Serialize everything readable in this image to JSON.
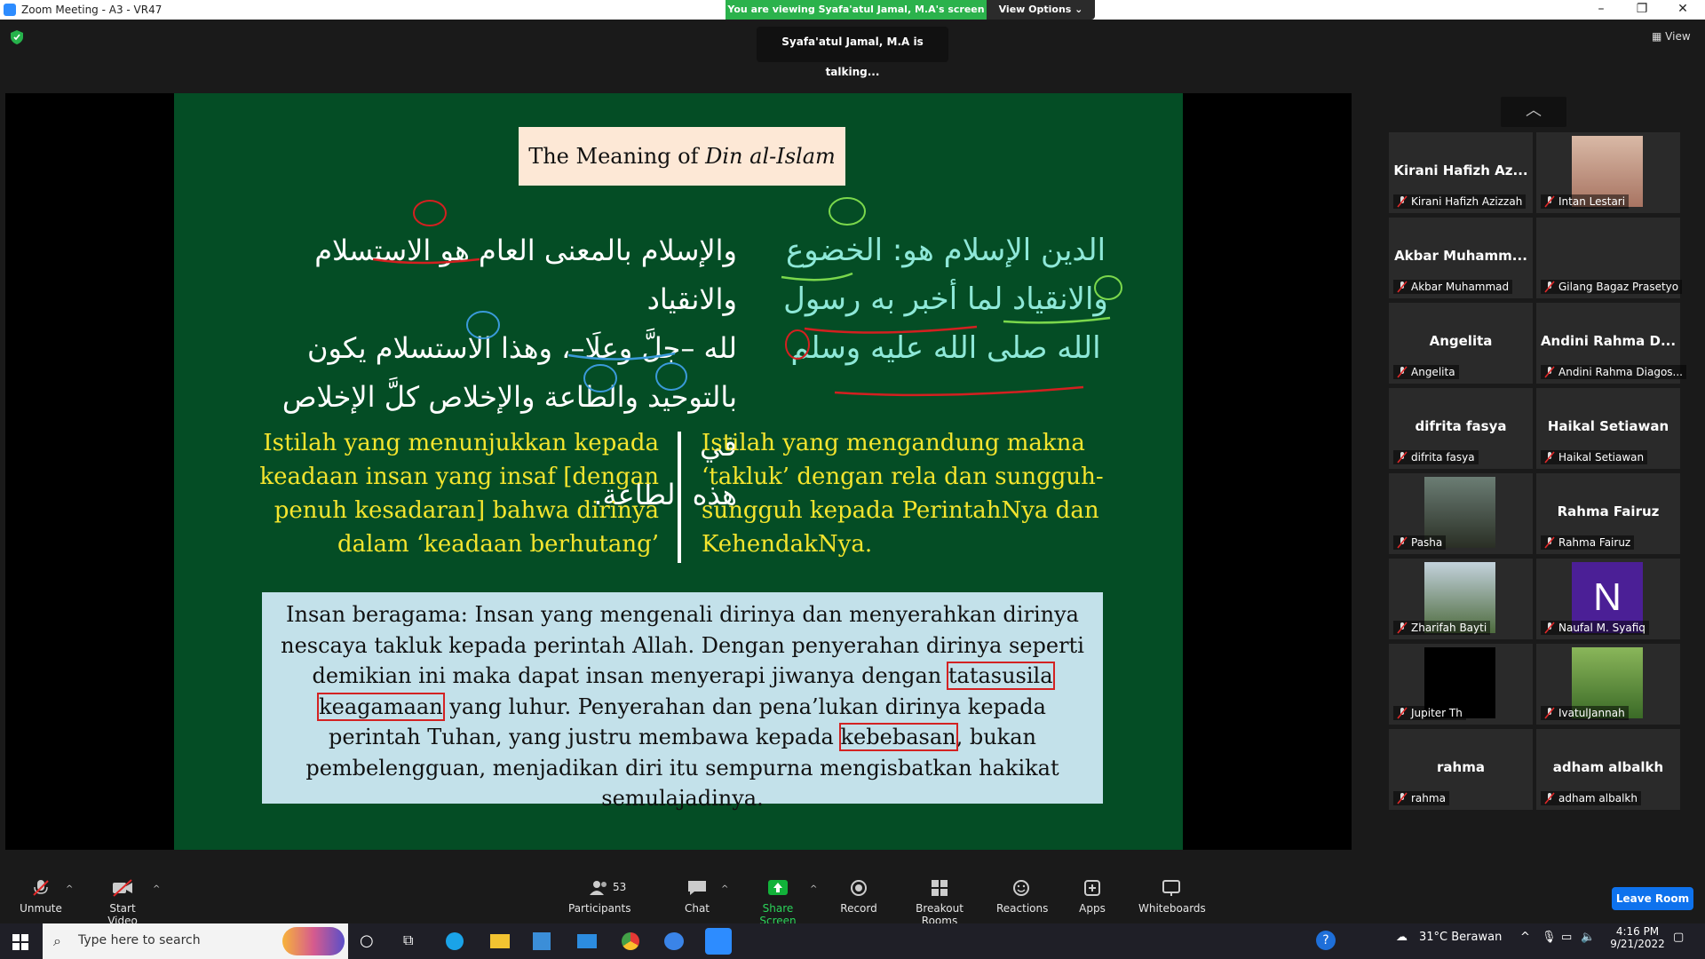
{
  "window": {
    "title": "Zoom Meeting - A3 - VR47"
  },
  "banner": {
    "viewing": "You are viewing Syafa'atul Jamal, M.A's screen",
    "view_options": "View Options"
  },
  "talking": "Syafa'atul Jamal, M.A is talking...",
  "view_button": "View",
  "slide": {
    "title_plain": "The Meaning of",
    "title_italic": "Din al-Islam",
    "arabic_left": [
      "والإسلام بالمعنى العام هو الاستسلام والانقياد",
      "لله –جلَّ وعلَا–، وهذا الاستسلام يكون",
      "بالتوحيد والطاعة والإخلاص كلَّ الإخلاص في",
      "هذه الطاعة."
    ],
    "arabic_right": [
      "الدين الإسلام هو: الخضوع",
      "والانقياد لما أخبر به رسول",
      "الله صلى الله عليه وسلم"
    ],
    "yellow_left": [
      "Istilah yang menunjukkan kepada",
      "keadaan insan yang insaf [dengan",
      "penuh kesadaran] bahwa dirinya",
      "dalam ‘keadaan berhutang’"
    ],
    "yellow_right": [
      "Istilah yang mengandung makna",
      "‘takluk’ dengan rela dan sungguh-",
      "sungguh kepada PerintahNya dan",
      "KehendakNya."
    ],
    "box": {
      "part1": "Insan beragama: Insan yang mengenali dirinya dan menyerahkan dirinya nescaya takluk kepada perintah Allah. Dengan penyerahan dirinya seperti demikian ini maka dapat insan menyerapi jiwanya dengan",
      "highlight1": "tatasusila keagamaan",
      "part2": "yang luhur. Penyerahan dan pena’lukan dirinya kepada perintah Tuhan, yang justru membawa kepada",
      "highlight2": "kebebasan",
      "part3": ", bukan pembelengguan, menjadikan diri itu sempurna mengisbatkan hakikat semulajadinya."
    }
  },
  "participants": [
    {
      "big": "Kirani Hafizh Az...",
      "label": "Kirani Hafizh Azizzah"
    },
    {
      "big": "",
      "label": "Intan Lestari",
      "photo": "woman-photo"
    },
    {
      "big": "Akbar Muhamm...",
      "label": "Akbar Muhammad"
    },
    {
      "big": "",
      "label": "Gilang Bagaz Prasetyo"
    },
    {
      "big": "Angelita",
      "label": "Angelita"
    },
    {
      "big": "Andini Rahma D...",
      "label": "Andini Rahma Diagos..."
    },
    {
      "big": "difrita fasya",
      "label": "difrita fasya"
    },
    {
      "big": "Haikal Setiawan",
      "label": "Haikal Setiawan"
    },
    {
      "big": "",
      "label": "Pasha",
      "photo": "tree-photo"
    },
    {
      "big": "Rahma Fairuz",
      "label": "Rahma Fairuz"
    },
    {
      "big": "",
      "label": "Zharifah Bayti",
      "photo": "garden-photo"
    },
    {
      "big": "N",
      "label": "Naufal M. Syafiq",
      "photo": "initial-avatar"
    },
    {
      "big": "",
      "label": "Jupiter Th",
      "photo": "black-photo"
    },
    {
      "big": "",
      "label": "IvatulJannah",
      "photo": "cartoon-photo"
    },
    {
      "big": "rahma",
      "label": "rahma"
    },
    {
      "big": "adham albalkh",
      "label": "adham albalkh"
    }
  ],
  "toolbar": {
    "unmute": "Unmute",
    "start_video": "Start Video",
    "participants": "Participants",
    "participants_count": "53",
    "chat": "Chat",
    "share_screen": "Share Screen",
    "record": "Record",
    "breakout": "Breakout Rooms",
    "reactions": "Reactions",
    "apps": "Apps",
    "whiteboards": "Whiteboards",
    "leave": "Leave Room"
  },
  "taskbar": {
    "search_placeholder": "Type here to search",
    "weather": "31°C  Berawan",
    "time": "4:16 PM",
    "date": "9/21/2022"
  }
}
